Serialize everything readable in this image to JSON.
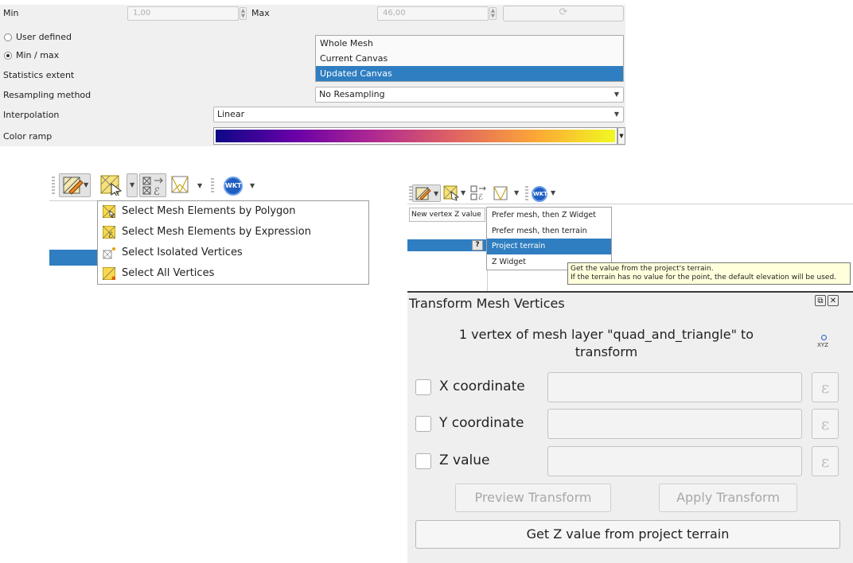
{
  "symbology": {
    "min_label": "Min",
    "min_value": "1,00",
    "max_label": "Max",
    "max_value": "46,00",
    "radio_user_defined": "User defined",
    "radio_min_max": "Min / max",
    "statistics_extent_label": "Statistics extent",
    "statistics_extent_options": [
      "Whole Mesh",
      "Current Canvas",
      "Updated Canvas"
    ],
    "statistics_extent_selected": "Updated Canvas",
    "resampling_label": "Resampling method",
    "resampling_value": "No Resampling",
    "interpolation_label": "Interpolation",
    "interpolation_value": "Linear",
    "color_ramp_label": "Color ramp",
    "color_ramp_stops": [
      "#0d0887",
      "#6a00a8",
      "#b12a90",
      "#e16462",
      "#fca636",
      "#f0f921"
    ]
  },
  "select_menu": {
    "items": [
      "Select Mesh Elements by Polygon",
      "Select Mesh Elements by Expression",
      "Select Isolated Vertices",
      "Select All Vertices"
    ]
  },
  "toolbar": {
    "wkt_label": "WKT"
  },
  "z_menu": {
    "new_vertex_label": "New vertex Z value",
    "help_label": "?",
    "items": [
      "Prefer mesh, then Z Widget",
      "Prefer mesh, then terrain",
      "Project terrain",
      "Z Widget"
    ],
    "selected": "Project terrain",
    "tooltip_line1": "Get the value from the project's terrain.",
    "tooltip_line2": "If the terrain has no value for the point, the default elevation will be used."
  },
  "transform": {
    "title": "Transform Mesh Vertices",
    "float_icon": "⧉",
    "close_icon": "✕",
    "info_line1": "1 vertex of mesh layer \"quad_and_triangle\" to",
    "info_line2": "transform",
    "xyz_label": "XYZ",
    "x_label": "X coordinate",
    "y_label": "Y coordinate",
    "z_label": "Z value",
    "epsilon": "ε",
    "preview_button": "Preview Transform",
    "apply_button": "Apply Transform",
    "get_z_button": "Get Z value from project terrain"
  }
}
